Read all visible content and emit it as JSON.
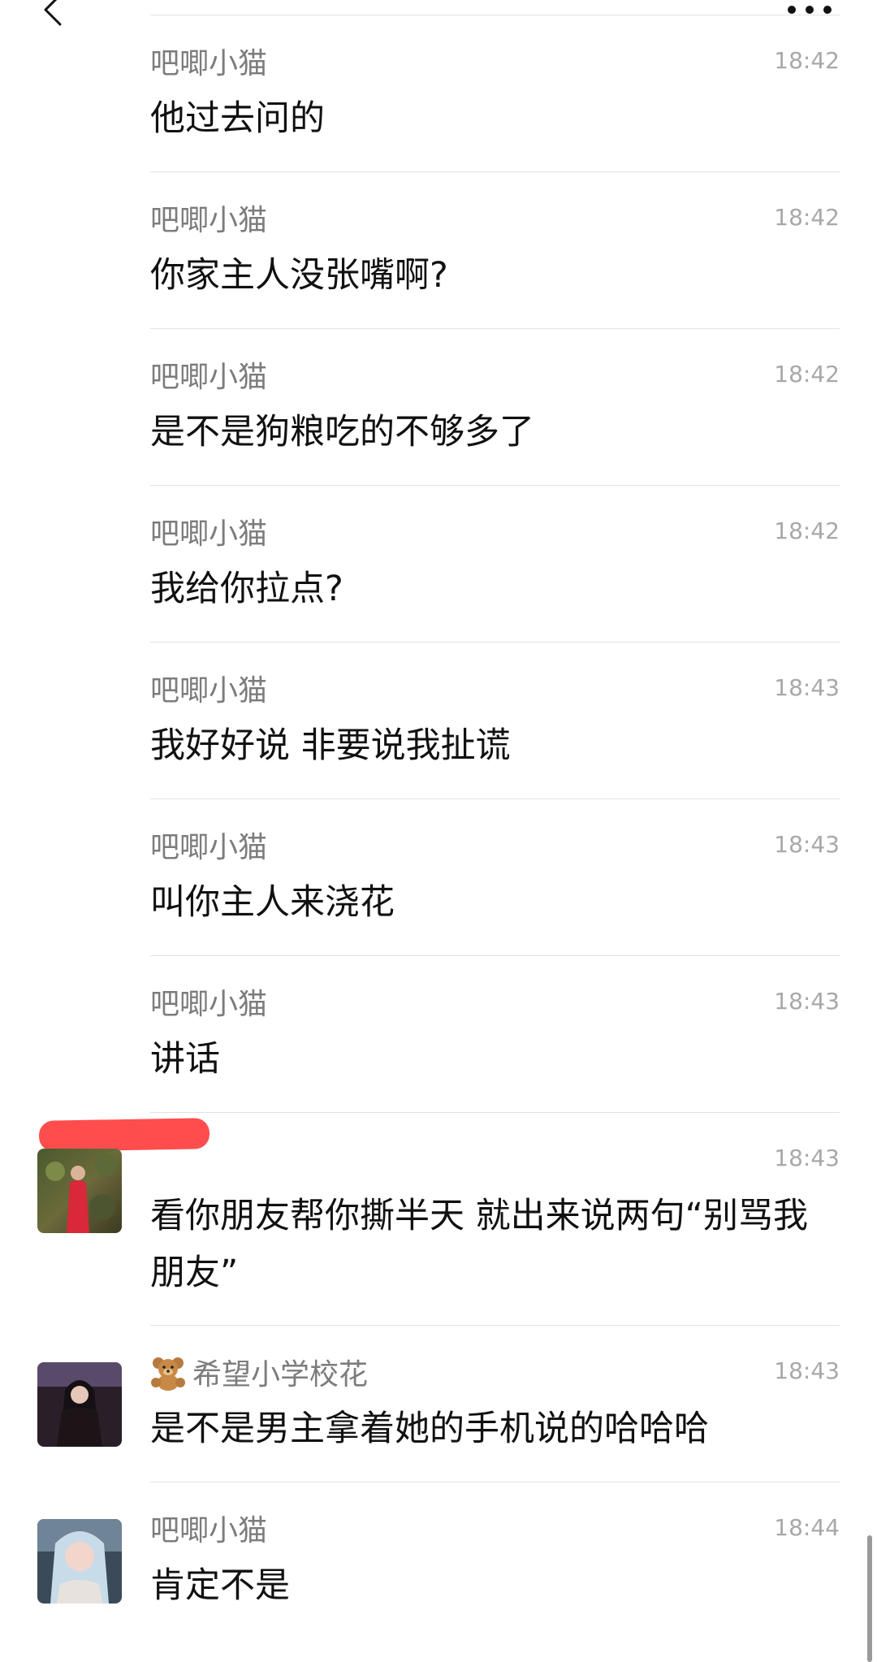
{
  "messages": [
    {
      "name": "吧唧小猫",
      "time": "18:42",
      "text": "他过去问的"
    },
    {
      "name": "吧唧小猫",
      "time": "18:42",
      "text": "你家主人没张嘴啊?"
    },
    {
      "name": "吧唧小猫",
      "time": "18:42",
      "text": "是不是狗粮吃的不够多了"
    },
    {
      "name": "吧唧小猫",
      "time": "18:42",
      "text": "我给你拉点?"
    },
    {
      "name": "吧唧小猫",
      "time": "18:43",
      "text": "我好好说 非要说我扯谎"
    },
    {
      "name": "吧唧小猫",
      "time": "18:43",
      "text": "叫你主人来浇花"
    },
    {
      "name": "吧唧小猫",
      "time": "18:43",
      "text": "讲话"
    },
    {
      "name": "",
      "time": "18:43",
      "text": "看你朋友帮你撕半天 就出来说两句“别骂我朋友”"
    },
    {
      "name": "希望小学校花",
      "time": "18:43",
      "text": "是不是男主拿着她的手机说的哈哈哈"
    },
    {
      "name": "吧唧小猫",
      "time": "18:44",
      "text": "肯定不是"
    }
  ],
  "icons": {
    "back": "chevron-left-icon",
    "more": "more-dots-icon",
    "name_emoji": "teddy-bear-icon"
  },
  "colors": {
    "name": "#7c7c7c",
    "time": "#a8a8a8",
    "divider": "#e2e2e2",
    "redaction": "#ff4d4d"
  }
}
